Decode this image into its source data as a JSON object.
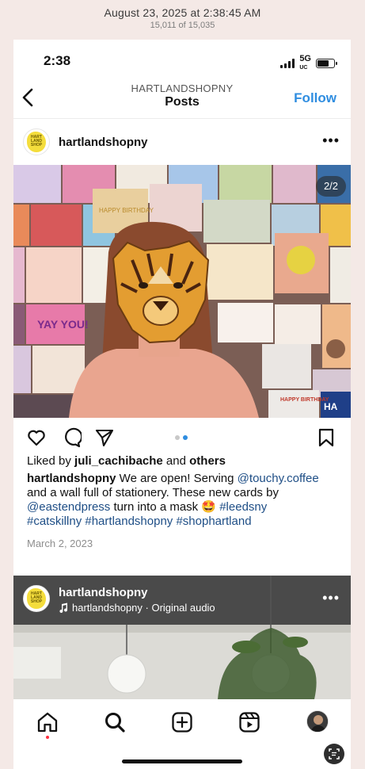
{
  "viewer": {
    "date": "August 23, 2025 at 2:38:45 AM",
    "count": "15,011 of 15,035"
  },
  "status": {
    "time": "2:38",
    "network": "5G",
    "network_sub": "UC"
  },
  "nav": {
    "username": "HARTLANDSHOPNY",
    "title": "Posts",
    "follow": "Follow"
  },
  "post": {
    "username": "hartlandshopny",
    "more": "•••",
    "page_indicator": "2/2",
    "logo_text": "HART LAND SHOP",
    "likes": {
      "prefix": "Liked by ",
      "user": "juli_cachibache",
      "middle": " and ",
      "others": "others"
    },
    "caption": {
      "user": "hartlandshopny",
      "t1": " We are open! Serving ",
      "link1": "@touchy.coffee",
      "t2": " and a wall full of stationery. These new cards by ",
      "link2": "@eastendpress",
      "t3": " turn into a mask 🤩  ",
      "tag1": "#leedsny",
      "tag2": "#catskillny",
      "tag3": "#hartlandshopny",
      "tag4": "#shophartland"
    },
    "date": "March 2, 2023",
    "card_texts": [
      "YAY YOU!",
      "HAPPY BIRTHDAY",
      "HAPPY BIRTHDAY",
      "HA"
    ]
  },
  "post2": {
    "username": "hartlandshopny",
    "audio": "hartlandshopny · Original audio",
    "more": "•••"
  },
  "colors": {
    "accent": "#2f8de0",
    "link": "#1e4e86",
    "notification": "#ff3040",
    "logo_yellow": "#f4dd3c"
  },
  "icons": {
    "back": "chevron-left-icon",
    "heart": "heart-icon",
    "comment": "comment-icon",
    "share": "send-icon",
    "save": "bookmark-icon",
    "home": "home-icon",
    "search": "search-icon",
    "create": "plus-square-icon",
    "reels": "reels-icon",
    "music": "music-note-icon",
    "scan": "live-text-icon"
  }
}
